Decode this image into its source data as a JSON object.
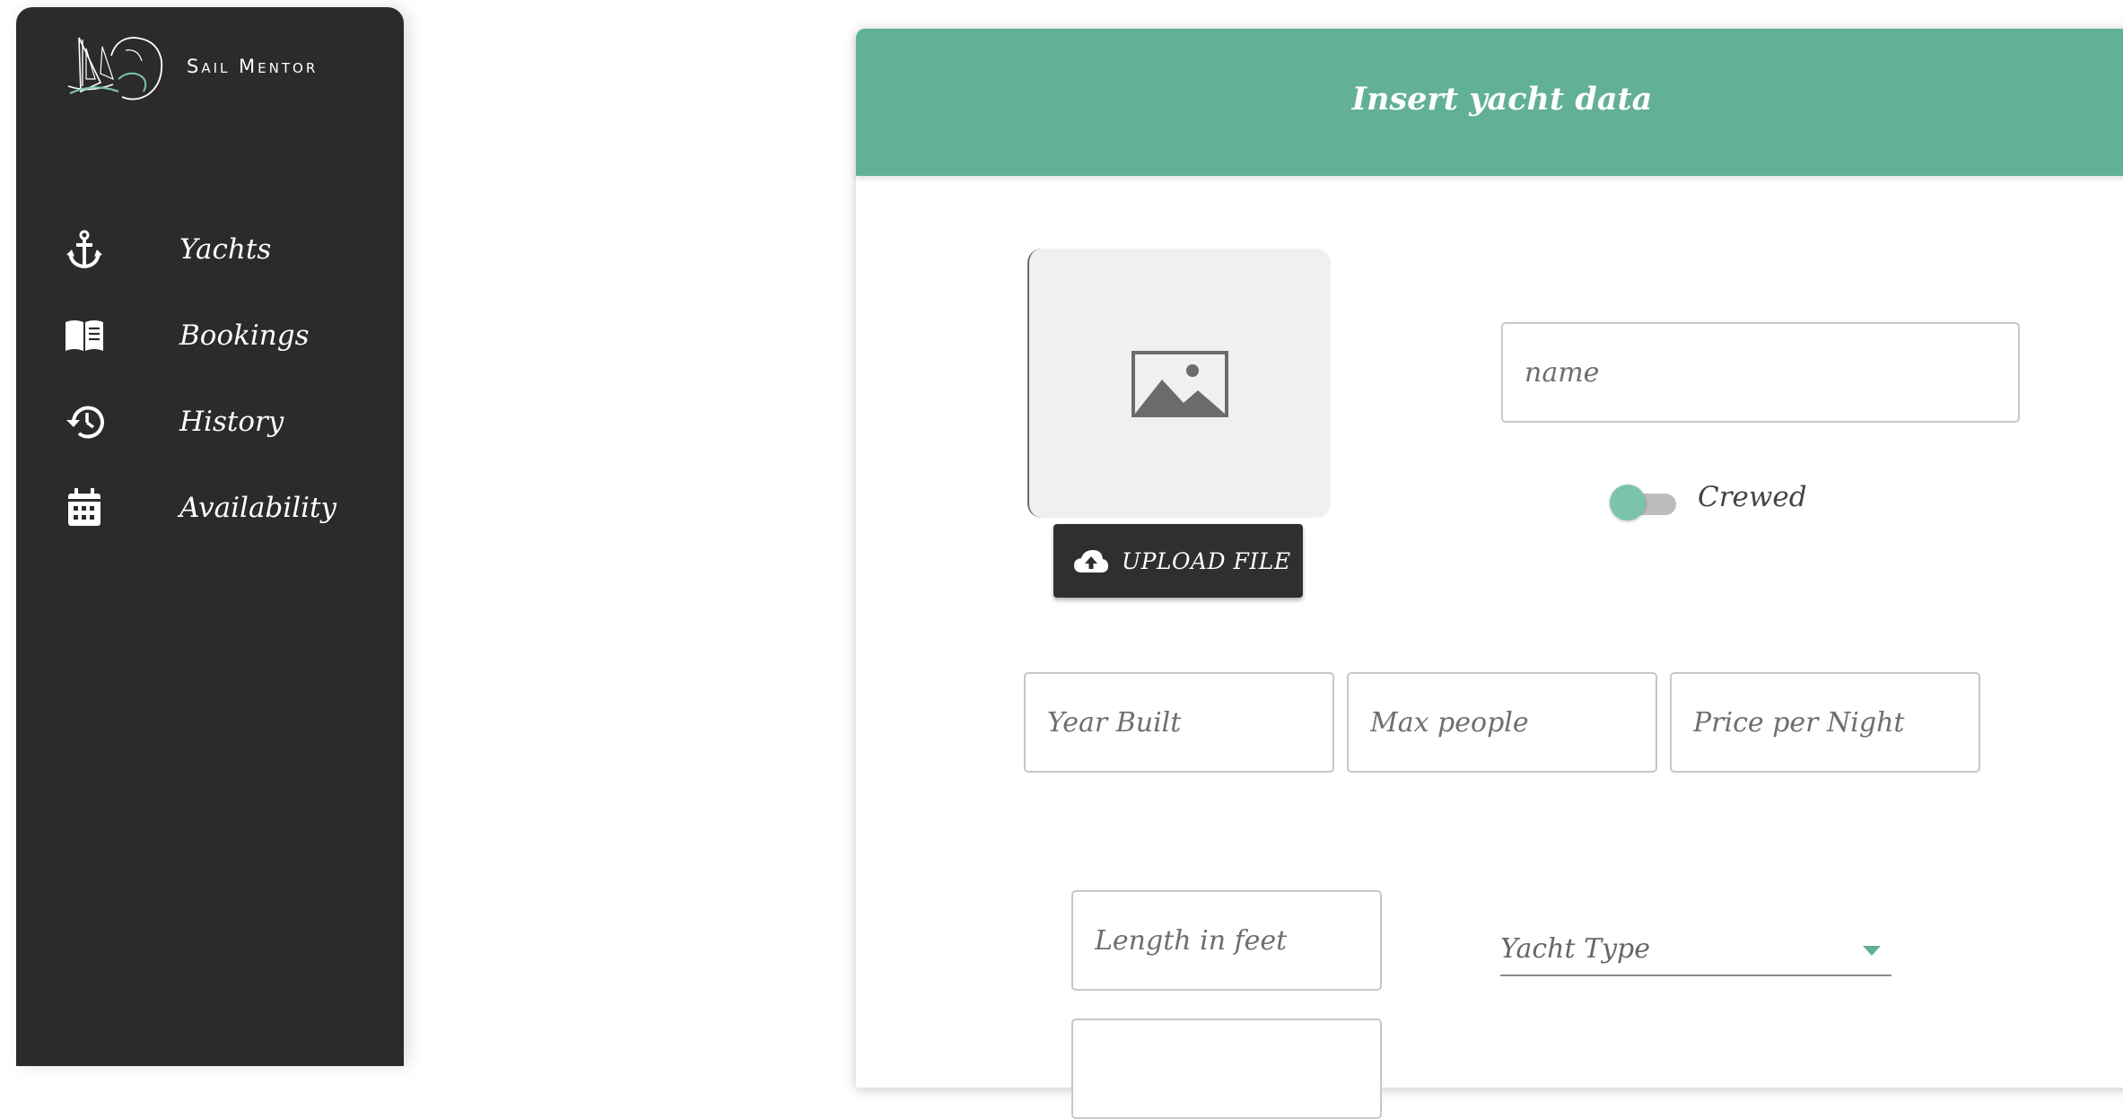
{
  "brand": {
    "name": "Sail Mentor",
    "logo_icon": "sailboat-logo-icon"
  },
  "sidebar": {
    "items": [
      {
        "label": "Yachts",
        "icon": "anchor-icon"
      },
      {
        "label": "Bookings",
        "icon": "book-icon"
      },
      {
        "label": "History",
        "icon": "history-icon"
      },
      {
        "label": "Availability",
        "icon": "calendar-icon"
      }
    ]
  },
  "form": {
    "title": "Insert yacht data",
    "image_placeholder_icon": "image-placeholder-icon",
    "upload_label": "UPLOAD FILE",
    "name_placeholder": "name",
    "crewed_label": "Crewed",
    "crewed_value": false,
    "year_built_placeholder": "Year Built",
    "max_people_placeholder": "Max people",
    "price_placeholder": "Price per Night",
    "length_placeholder": "Length in feet",
    "yacht_type_label": "Yacht Type"
  },
  "colors": {
    "accent": "#62b096",
    "sidebar_bg": "#2b2b2b",
    "toggle_thumb": "#7cc3ac"
  }
}
